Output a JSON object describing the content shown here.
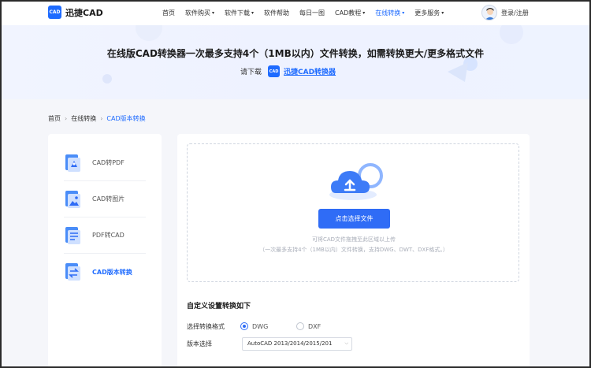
{
  "header": {
    "logo_mark": "CAD",
    "logo_text": "迅捷CAD",
    "nav": [
      {
        "label": "首页",
        "caret": false,
        "active": false
      },
      {
        "label": "软件购买",
        "caret": true,
        "active": false
      },
      {
        "label": "软件下载",
        "caret": true,
        "active": false
      },
      {
        "label": "软件帮助",
        "caret": false,
        "active": false
      },
      {
        "label": "每日一图",
        "caret": false,
        "active": false
      },
      {
        "label": "CAD教程",
        "caret": true,
        "active": false
      },
      {
        "label": "在线转换",
        "caret": true,
        "active": true
      },
      {
        "label": "更多服务",
        "caret": true,
        "active": false
      }
    ],
    "login": "登录/注册",
    "accent": "#1e6bff"
  },
  "banner": {
    "title": "在线版CAD转换器一次最多支持4个（1MB以内）文件转换，如需转换更大/更多格式文件",
    "download_prefix": "请下载",
    "mini_logo": "CAD",
    "download_link": "迅捷CAD转换器"
  },
  "breadcrumb": {
    "items": [
      "首页",
      "在线转换",
      "CAD版本转换"
    ],
    "sep": "›"
  },
  "sidebar": {
    "items": [
      {
        "label": "CAD转PDF",
        "active": false
      },
      {
        "label": "CAD转图片",
        "active": false
      },
      {
        "label": "PDF转CAD",
        "active": false
      },
      {
        "label": "CAD版本转换",
        "active": true
      }
    ]
  },
  "upload": {
    "button": "点击选择文件",
    "hint1": "可将CAD文件拖拽至此区域以上传",
    "hint2": "（一次最多支持4个（1MB以内）文件转换，支持DWG、DWT、DXF格式。）"
  },
  "settings": {
    "title": "自定义设置转换如下",
    "format_label": "选择转换格式",
    "format_options": [
      "DWG",
      "DXF"
    ],
    "format_selected": "DWG",
    "version_label": "版本选择",
    "version_value": "AutoCAD 2013/2014/2015/201"
  }
}
